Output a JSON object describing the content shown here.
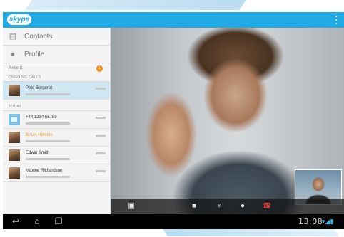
{
  "app": {
    "logo_text": "skype",
    "accent_color": "#22aae4"
  },
  "sidebar": {
    "nav": [
      {
        "label": "Contacts",
        "icon": "contacts-icon"
      },
      {
        "label": "Profile",
        "icon": "profile-icon"
      }
    ],
    "recent": {
      "label": "Recent",
      "badge": "1"
    },
    "sections": {
      "ongoing": "ONGOING CALLS",
      "today": "TODAY"
    },
    "active_call": {
      "name": "Pete Bergeret"
    },
    "contacts": [
      {
        "name": "+44 1234 56789",
        "highlight": false
      },
      {
        "name": "Bryan Holmes",
        "highlight": true
      },
      {
        "name": "Edwin Smith",
        "highlight": false
      },
      {
        "name": "Maxine Richardson",
        "highlight": false
      }
    ]
  },
  "call_controls": [
    {
      "name": "screen-share-icon",
      "glyph": "▣"
    },
    {
      "name": "video-toggle-icon",
      "glyph": "■"
    },
    {
      "name": "microphone-icon",
      "glyph": "♆"
    },
    {
      "name": "chat-icon",
      "glyph": "●"
    },
    {
      "name": "end-call-icon",
      "glyph": "☎"
    }
  ],
  "system_bar": {
    "time": "13:08",
    "buttons": [
      "back-icon",
      "home-icon",
      "recent-apps-icon"
    ]
  }
}
